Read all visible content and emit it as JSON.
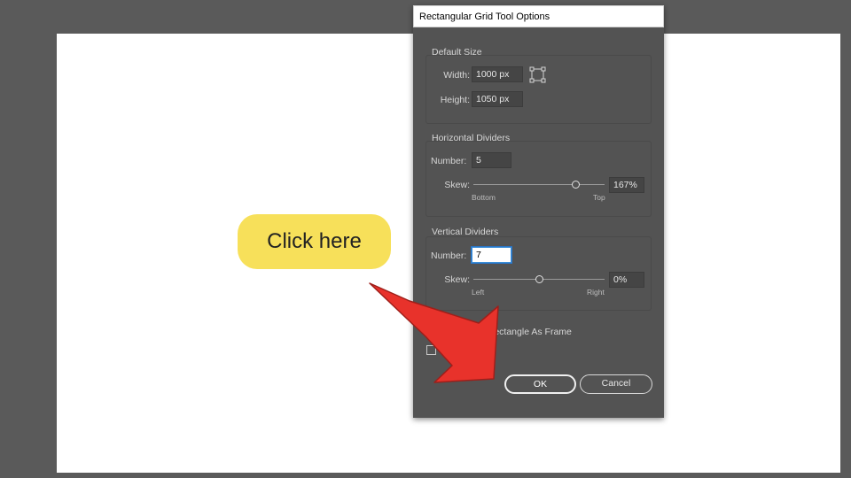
{
  "dialog": {
    "title": "Rectangular Grid Tool Options",
    "default_size": {
      "title": "Default Size",
      "width_label": "Width:",
      "width_value": "1000 px",
      "height_label": "Height:",
      "height_value": "1050 px",
      "reference_point_icon": "reference-point-icon"
    },
    "horizontal_dividers": {
      "title": "Horizontal Dividers",
      "number_label": "Number:",
      "number_value": "5",
      "skew_label": "Skew:",
      "skew_value": "167%",
      "skew_fraction": 0.78,
      "left_caption": "Bottom",
      "right_caption": "Top"
    },
    "vertical_dividers": {
      "title": "Vertical Dividers",
      "number_label": "Number:",
      "number_value": "7",
      "skew_label": "Skew:",
      "skew_value": "0%",
      "skew_fraction": 0.5,
      "left_caption": "Left",
      "right_caption": "Right"
    },
    "frame_option_label": "e Rectangle As Frame",
    "ok_label": "OK",
    "cancel_label": "Cancel"
  },
  "callout": {
    "text": "Click here",
    "color": "#f7e05a"
  },
  "arrow": {
    "color": "#e8322b"
  }
}
